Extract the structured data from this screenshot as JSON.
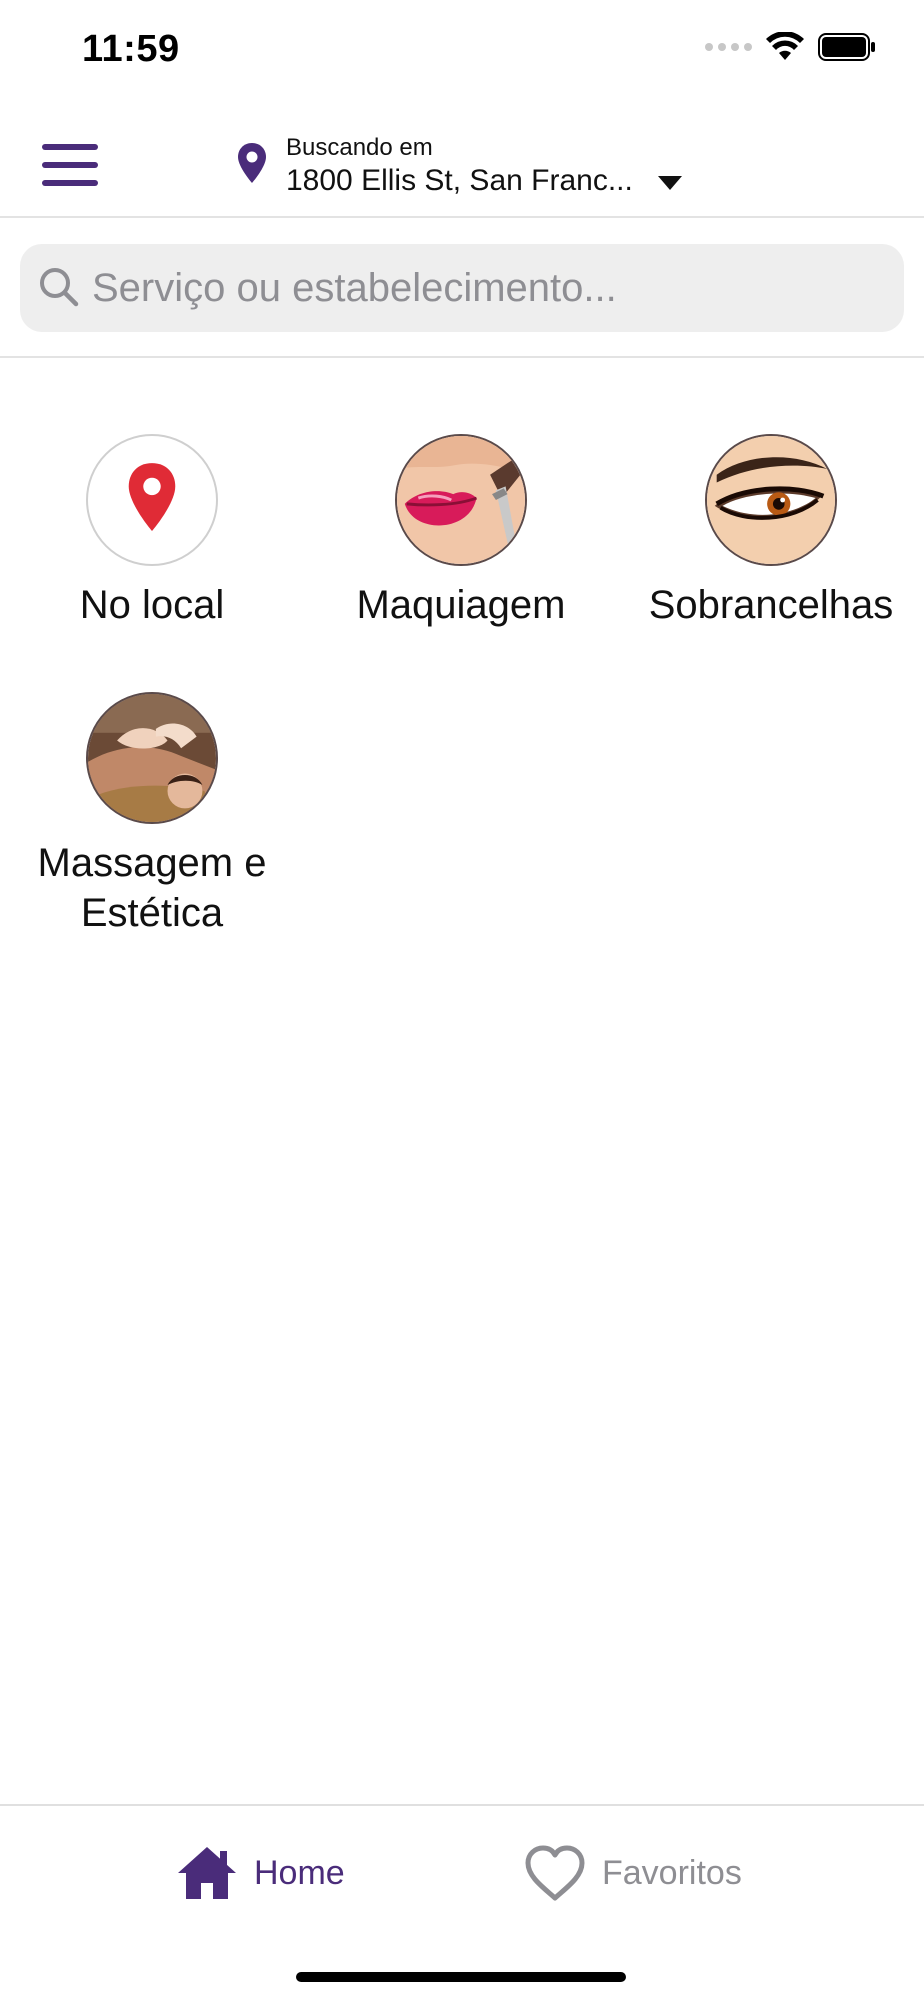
{
  "status_bar": {
    "time": "11:59"
  },
  "header": {
    "location_caption": "Buscando em",
    "location_address": "1800 Ellis St, San Franc..."
  },
  "search": {
    "placeholder": "Serviço ou estabelecimento..."
  },
  "categories": [
    {
      "label": "No local",
      "icon": "location-pin-icon"
    },
    {
      "label": "Maquiagem",
      "icon": "makeup-lips-brush"
    },
    {
      "label": "Sobrancelhas",
      "icon": "eye-eyebrow"
    },
    {
      "label": "Massagem e Estética",
      "icon": "massage-woman"
    }
  ],
  "tab_bar": {
    "home_label": "Home",
    "favorites_label": "Favoritos"
  },
  "colors": {
    "accent": "#4a2c7a",
    "pin_red": "#e02b36",
    "inactive": "#8e8e93",
    "search_bg": "#eeeeee"
  }
}
